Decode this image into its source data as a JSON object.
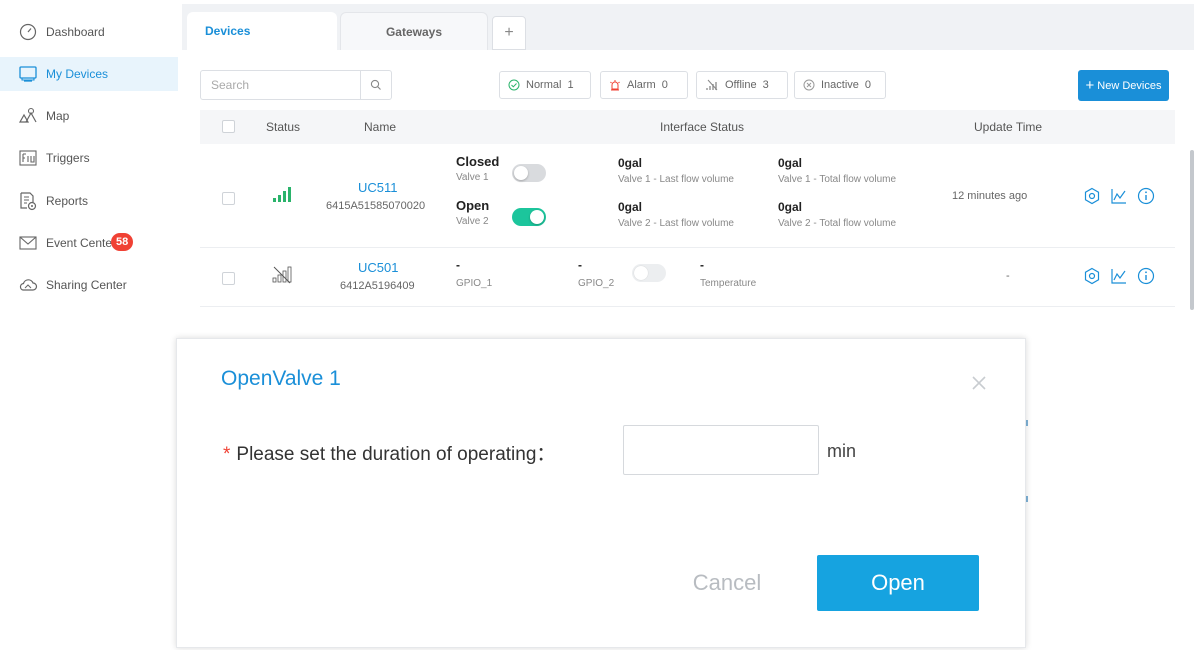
{
  "sidebar": {
    "items": [
      {
        "label": "Dashboard",
        "icon": "dashboard-icon"
      },
      {
        "label": "My Devices",
        "icon": "monitor-icon",
        "active": true
      },
      {
        "label": "Map",
        "icon": "map-icon"
      },
      {
        "label": "Triggers",
        "icon": "triggers-icon"
      },
      {
        "label": "Reports",
        "icon": "reports-icon"
      },
      {
        "label": "Event Center",
        "icon": "mail-icon",
        "badge": "58"
      },
      {
        "label": "Sharing Center",
        "icon": "cloud-icon"
      }
    ]
  },
  "tabs": {
    "devices": "Devices",
    "gateways": "Gateways",
    "add": "+"
  },
  "toolbar": {
    "search_placeholder": "Search",
    "filters": {
      "normal": {
        "label": "Normal",
        "count": "1"
      },
      "alarm": {
        "label": "Alarm",
        "count": "0"
      },
      "offline": {
        "label": "Offline",
        "count": "3"
      },
      "inactive": {
        "label": "Inactive",
        "count": "0"
      }
    },
    "new_devices": "New Devices"
  },
  "table": {
    "headers": {
      "status": "Status",
      "name": "Name",
      "interface": "Interface Status",
      "update": "Update Time"
    },
    "rows": [
      {
        "name": "UC511",
        "sn": "6415A51585070020",
        "valve1_state": "Closed",
        "valve1_label": "Valve 1",
        "valve2_state": "Open",
        "valve2_label": "Valve 2",
        "m1_value": "0gal",
        "m1_label": "Valve 1 - Last flow volume",
        "m2_value": "0gal",
        "m2_label": "Valve 1 - Total flow volume",
        "m3_value": "0gal",
        "m3_label": "Valve 2 - Last flow volume",
        "m4_value": "0gal",
        "m4_label": "Valve 2 - Total flow volume",
        "update": "12 minutes ago"
      },
      {
        "name": "UC501",
        "sn": "6412A5196409",
        "gpio1_value": "-",
        "gpio1_label": "GPIO_1",
        "gpio2_value": "-",
        "gpio2_label": "GPIO_2",
        "temp_value": "-",
        "temp_label": "Temperature",
        "update": "-"
      }
    ]
  },
  "modal": {
    "title": "OpenValve 1",
    "required_mark": "*",
    "label": "Please set the duration of operating：",
    "input_value": "",
    "unit": "min",
    "cancel": "Cancel",
    "open": "Open"
  },
  "colors": {
    "accent": "#1a8fd8",
    "toggle_on": "#1cc59c",
    "badge": "#f04134",
    "signal": "#2ab36b"
  }
}
